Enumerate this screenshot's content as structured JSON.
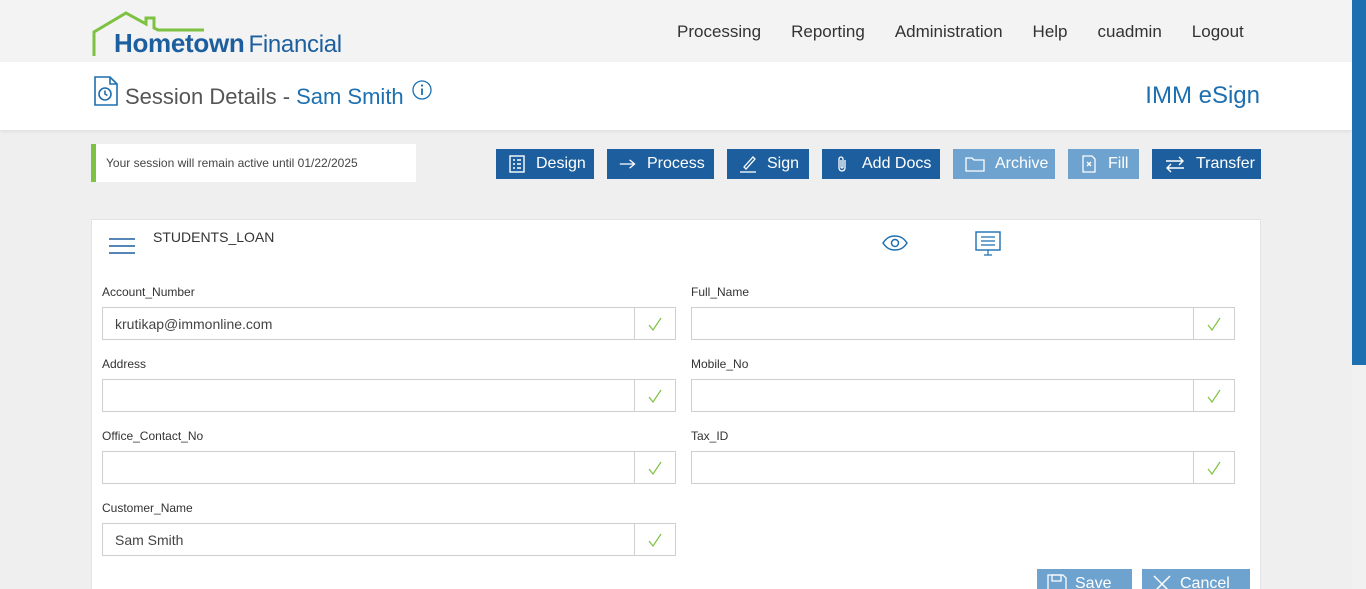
{
  "header": {
    "logo_bold": "Hometown",
    "logo_light": "Financial",
    "nav": [
      "Processing",
      "Reporting",
      "Administration",
      "Help",
      "cuadmin",
      "Logout"
    ]
  },
  "title_bar": {
    "title": "Session Details -",
    "name": "Sam Smith",
    "brand": "IMM eSign"
  },
  "session_notice": "Your session will remain active until 01/22/2025",
  "toolbar": {
    "design": "Design",
    "process": "Process",
    "sign": "Sign",
    "add_docs": "Add Docs",
    "archive": "Archive",
    "fill": "Fill",
    "transfer": "Transfer"
  },
  "form": {
    "document_name": "STUDENTS_LOAN",
    "fields": [
      {
        "label": "Account_Number",
        "value": "krutikap@immonline.com"
      },
      {
        "label": "Full_Name",
        "value": ""
      },
      {
        "label": "Address",
        "value": ""
      },
      {
        "label": "Mobile_No",
        "value": ""
      },
      {
        "label": "Office_Contact_No",
        "value": ""
      },
      {
        "label": "Tax_ID",
        "value": ""
      },
      {
        "label": "Customer_Name",
        "value": "Sam Smith"
      }
    ],
    "save": "Save",
    "cancel": "Cancel"
  },
  "colors": {
    "primary": "#1d5f9e",
    "disabled_button": "#6ea3cf",
    "accent_green": "#7dc242",
    "check_green": "#7dc242",
    "title_blue": "#1d6fb0"
  },
  "icons": {
    "design": "list-icon",
    "process": "arrow-right-icon",
    "sign": "pen-icon",
    "add_docs": "paperclip-icon",
    "archive": "folder-icon",
    "fill": "document-x-icon",
    "transfer": "swap-arrows-icon",
    "save": "floppy-icon",
    "cancel": "close-icon"
  }
}
